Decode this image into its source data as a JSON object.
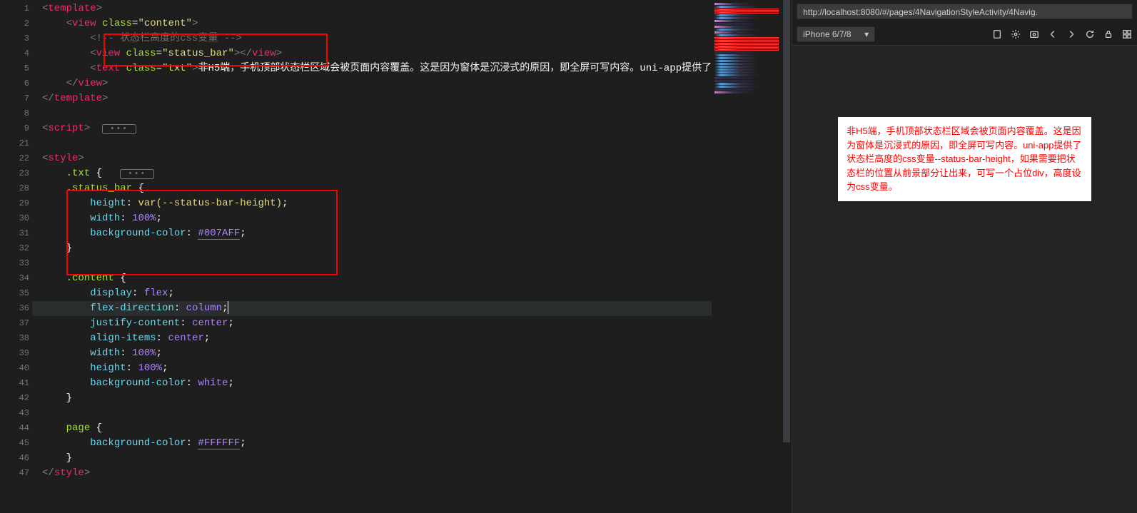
{
  "gutter_lines": [
    "1",
    "2",
    "3",
    "4",
    "5",
    "6",
    "7",
    "8",
    "9",
    "21",
    "22",
    "23",
    "28",
    "29",
    "30",
    "31",
    "32",
    "33",
    "34",
    "35",
    "36",
    "37",
    "38",
    "39",
    "40",
    "41",
    "42",
    "43",
    "44",
    "45",
    "46",
    "47"
  ],
  "fold_lines": [
    0,
    1,
    8,
    10,
    11,
    12,
    18,
    28
  ],
  "code": {
    "l1": {
      "tag": "template"
    },
    "l2": {
      "tag": "view",
      "attr": "class",
      "val": "content"
    },
    "l3": {
      "comment": "<!-- 状态栏高度的css变量 -->"
    },
    "l4": {
      "tag": "view",
      "attr": "class",
      "val": "status_bar"
    },
    "l5": {
      "tag": "text",
      "attr": "class",
      "val": "txt",
      "text": "非H5端，手机顶部状态栏区域会被页面内容覆盖。这是因为窗体是沉浸式的原因，即全屏可写内容。uni-app提供了"
    },
    "l6": {
      "close": "view"
    },
    "l7": {
      "close": "template"
    },
    "l9": {
      "tag": "script"
    },
    "l22": {
      "tag": "style"
    },
    "l23": {
      "sel": ".txt"
    },
    "l28": {
      "sel": ".status_bar"
    },
    "l29": {
      "prop": "height",
      "val": "var(--status-bar-height)"
    },
    "l30": {
      "prop": "width",
      "val": "100%"
    },
    "l31": {
      "prop": "background-color",
      "hex": "#007AFF"
    },
    "l34": {
      "sel": ".content"
    },
    "l35": {
      "prop": "display",
      "val": "flex"
    },
    "l36": {
      "prop": "flex-direction",
      "val": "column"
    },
    "l37": {
      "prop": "justify-content",
      "val": "center"
    },
    "l38": {
      "prop": "align-items",
      "val": "center"
    },
    "l39": {
      "prop": "width",
      "val": "100%"
    },
    "l40": {
      "prop": "height",
      "val": "100%"
    },
    "l41": {
      "prop": "background-color",
      "val": "white"
    },
    "l44": {
      "sel": "page"
    },
    "l45": {
      "prop": "background-color",
      "hex": "#FFFFFF"
    },
    "l47": {
      "close": "style"
    }
  },
  "devtools": {
    "url": "http://localhost:8080/#/pages/4NavigationStyleActivity/4Navig.",
    "device": "iPhone 6/7/8",
    "preview_text": "非H5端，手机顶部状态栏区域会被页面内容覆盖。这是因为窗体是沉浸式的原因，即全屏可写内容。uni-app提供了状态栏高度的css变量--status-bar-height，如果需要把状态栏的位置从前景部分让出来，可写一个占位div，高度设为css变量。"
  }
}
